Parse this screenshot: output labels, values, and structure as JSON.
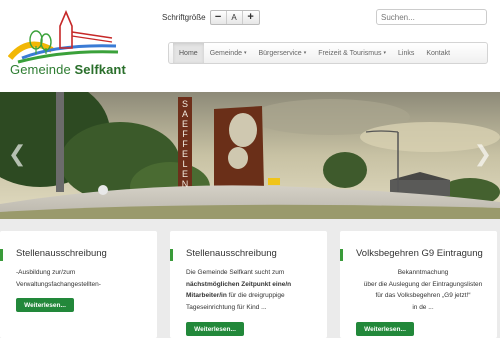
{
  "logo": {
    "prefix": "Gemeinde",
    "name": "Selfkant"
  },
  "font_size": {
    "label": "Schriftgröße",
    "decrease": "−",
    "reset": "A",
    "increase": "+"
  },
  "search": {
    "placeholder": "Suchen..."
  },
  "nav": {
    "items": [
      {
        "label": "Home",
        "caret": ""
      },
      {
        "label": "Gemeinde",
        "caret": "▾"
      },
      {
        "label": "Bürgerservice",
        "caret": "▾"
      },
      {
        "label": "Freizeit & Tourismus",
        "caret": "▾"
      },
      {
        "label": "Links",
        "caret": ""
      },
      {
        "label": "Kontakt",
        "caret": ""
      }
    ]
  },
  "banner": {
    "sign_text": [
      "S",
      "A",
      "E",
      "F",
      "F",
      "E",
      "L",
      "E",
      "N"
    ],
    "prev": "❮",
    "next": "❯"
  },
  "cards": [
    {
      "title": "Stellenausschreibung",
      "lines": [
        "-Ausbildung zur/zum",
        "Verwaltungsfachangestellten-"
      ],
      "button": "Weiterlesen..."
    },
    {
      "title": "Stellenausschreibung",
      "line1": "Die Gemeinde Selfkant sucht zum",
      "line2_bold": "nächstmöglichen Zeitpunkt eine/n",
      "line3_bold": "Mitarbeiter/in",
      "line3_rest": " für die dreigruppige",
      "line4": "Tageseinrichtung für Kind ...",
      "button": "Weiterlesen..."
    },
    {
      "title": "Volksbegehren G9 Eintragung",
      "lines": [
        "Bekanntmachung",
        "über die Auslegung der Eintragungslisten",
        "für das Volksbegehren „G9 jetzt!“",
        "in de ..."
      ],
      "button": "Weiterlesen..."
    }
  ],
  "colors": {
    "accent_green": "#22883a",
    "logo_red": "#c62828",
    "logo_green": "#2e7d32"
  }
}
